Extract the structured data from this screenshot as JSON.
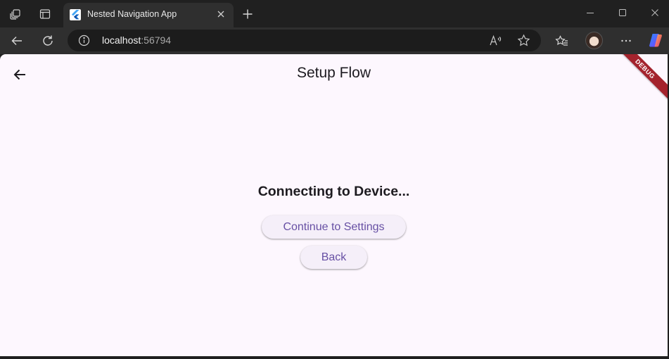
{
  "browser": {
    "tab": {
      "title": "Nested Navigation App"
    },
    "address": {
      "host": "localhost",
      "port": ":56794"
    },
    "icons": {
      "workspaces": "workspaces-icon",
      "tab_actions": "tab-actions-icon",
      "favicon": "flutter-icon",
      "close_tab": "close-icon",
      "new_tab": "plus-icon",
      "minimize": "minimize-icon",
      "maximize": "maximize-icon",
      "close_window": "close-icon",
      "back": "arrow-left-icon",
      "refresh": "refresh-icon",
      "site_info": "info-icon",
      "read_aloud": "read-aloud-icon",
      "favorite": "star-icon",
      "favorites": "favorites-icon",
      "profile": "avatar",
      "more": "more-icon",
      "copilot": "copilot-icon"
    }
  },
  "app": {
    "appbar": {
      "title": "Setup Flow"
    },
    "debug_banner": "DEBUG",
    "status": "Connecting to Device...",
    "buttons": {
      "continue": "Continue to Settings",
      "back": "Back"
    },
    "colors": {
      "background": "#fdf7fe",
      "button_text": "#6750a4",
      "button_bg": "#f5eff9",
      "debug_banner": "#a4232d"
    }
  }
}
